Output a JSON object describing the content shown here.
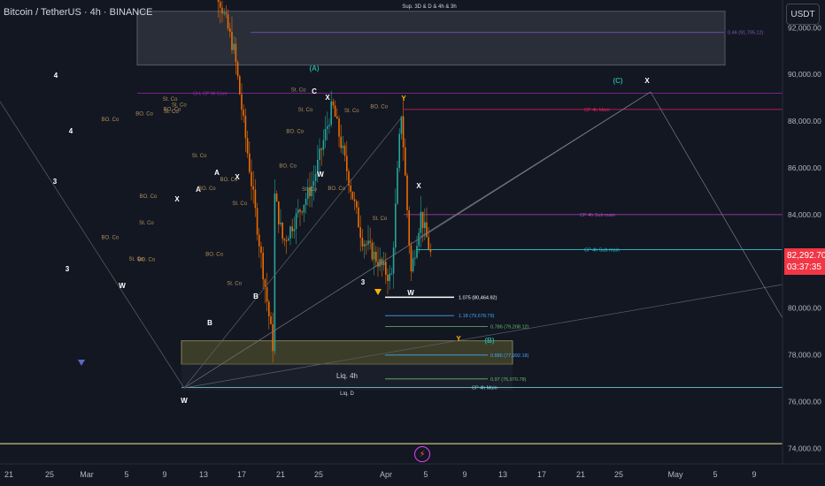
{
  "header": {
    "symbol_title": "Bitcoin / TetherUS · 4h · BINANCE"
  },
  "price_scale": {
    "currency": "USDT",
    "ticks": [
      "92,000.00",
      "90,000.00",
      "88,000.00",
      "86,000.00",
      "84,000.00",
      "82,292.70",
      "80,000.00",
      "78,000.00",
      "76,000.00",
      "74,000.00"
    ],
    "last_price": "82,292.70",
    "countdown": "03:37:35"
  },
  "time_axis": {
    "labels": [
      "21",
      "25",
      "Mar",
      "5",
      "9",
      "13",
      "17",
      "21",
      "25",
      "Apr",
      "5",
      "9",
      "13",
      "17",
      "21",
      "25",
      "May",
      "5",
      "9"
    ]
  },
  "colors": {
    "background": "#131722",
    "up": "#26a69a",
    "down": "#ef6c00",
    "accent_purple": "#9c27b0",
    "accent_teal": "#26c6da",
    "zone_yellow": "#5c5a2e",
    "zone_gray": "#2a2e39"
  },
  "chart_data": {
    "type": "candlestick",
    "symbol": "BTCUSDT",
    "timeframe": "4h",
    "ylim": [
      73500,
      93500
    ],
    "grid": false,
    "last_price": 82292.7,
    "swing_points": [
      {
        "t": "Feb 21",
        "price": 95500
      },
      {
        "t": "Feb 24",
        "price": 91000
      },
      {
        "t": "Feb 28",
        "price": 78200
      },
      {
        "t": "Mar 2",
        "price": 95000
      },
      {
        "t": "Mar 4",
        "price": 90600
      },
      {
        "t": "Mar 10",
        "price": 76600
      },
      {
        "t": "Mar 13",
        "price": 80000
      },
      {
        "t": "Mar 17",
        "price": 81200
      },
      {
        "t": "Mar 19",
        "price": 87400
      },
      {
        "t": "Mar 21",
        "price": 82800
      },
      {
        "t": "Mar 24",
        "price": 85300
      },
      {
        "t": "Mar 26",
        "price": 88700
      },
      {
        "t": "Mar 29",
        "price": 83000
      },
      {
        "t": "Apr 1",
        "price": 81200
      },
      {
        "t": "Apr 2",
        "price": 88500
      },
      {
        "t": "Apr 3",
        "price": 81500
      },
      {
        "t": "Apr 4",
        "price": 84000
      },
      {
        "t": "Apr 5",
        "price": 82293
      }
    ],
    "levels": [
      {
        "label": "Sup. 3D & D & 4h & 3h",
        "price": 91300,
        "zone": [
          90400,
          92700
        ]
      },
      {
        "label": "0.46 (91,795.12)",
        "price": 91795.12
      },
      {
        "label": "CH, CP W Core",
        "price": 89200
      },
      {
        "label": "CP 4h Main",
        "price": 88500
      },
      {
        "label": "CP 4h Sub main",
        "price": 84000
      },
      {
        "label": "CP 4h Sub main",
        "price": 82500
      },
      {
        "label": "1.075 (80,464.92)",
        "price": 80464.92
      },
      {
        "label": "1.18 (79,678.79)",
        "price": 79678.79
      },
      {
        "label": "0.786 (79,208.12)",
        "price": 79208.12
      },
      {
        "label": "0.886 (77,992.18)",
        "price": 77992.18
      },
      {
        "label": "0.97 (76,970.78)",
        "price": 76970.78
      },
      {
        "label": "CP 4h Main",
        "price": 76600
      },
      {
        "label": "Liq. 4h",
        "zone": [
          77600,
          78600
        ]
      },
      {
        "label": "Liq. D",
        "price": 76600
      }
    ],
    "wave_labels": [
      {
        "text": "(A)",
        "color": "#26a69a"
      },
      {
        "text": "(B)",
        "color": "#26a69a"
      },
      {
        "text": "(C)",
        "color": "#26a69a"
      },
      {
        "text": "X",
        "color": "#ffffff"
      },
      {
        "text": "Y",
        "color": "#ffb300"
      },
      {
        "text": "W",
        "color": "#ffffff"
      },
      {
        "text": "A",
        "color": "#ffffff"
      },
      {
        "text": "B",
        "color": "#ffffff"
      },
      {
        "text": "C",
        "color": "#ffffff"
      },
      {
        "text": "St. Co",
        "color": "#b08f5a"
      },
      {
        "text": "BO. Co",
        "color": "#b08f5a"
      },
      {
        "text": "3",
        "color": "#ffffff"
      },
      {
        "text": "4",
        "color": "#ffffff"
      }
    ]
  }
}
